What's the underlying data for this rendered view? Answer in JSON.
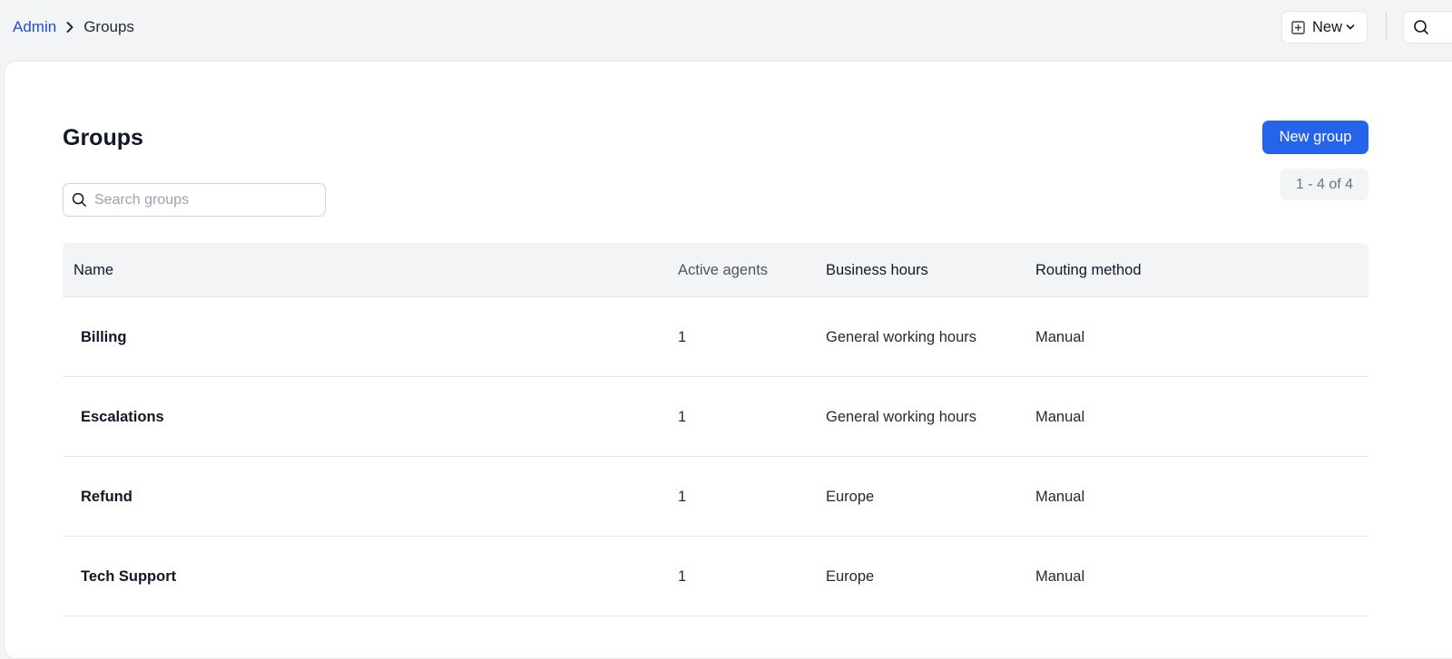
{
  "breadcrumb": {
    "parent": "Admin",
    "current": "Groups"
  },
  "topbar": {
    "new_label": "New",
    "icons": [
      "plus-square-icon",
      "chevron-down-icon",
      "search-icon"
    ]
  },
  "page": {
    "title": "Groups",
    "primary_button": "New group",
    "search_placeholder": "Search groups",
    "pagination": "1 - 4 of 4"
  },
  "table": {
    "columns": {
      "name": "Name",
      "agents": "Active agents",
      "hours": "Business hours",
      "routing": "Routing method"
    },
    "rows": [
      {
        "name": "Billing",
        "agents": "1",
        "hours": "General working hours",
        "routing": "Manual"
      },
      {
        "name": "Escalations",
        "agents": "1",
        "hours": "General working hours",
        "routing": "Manual"
      },
      {
        "name": "Refund",
        "agents": "1",
        "hours": "Europe",
        "routing": "Manual"
      },
      {
        "name": "Tech Support",
        "agents": "1",
        "hours": "Europe",
        "routing": "Manual"
      }
    ]
  },
  "colors": {
    "accent": "#2563eb",
    "link": "#1d4ed8",
    "background": "#f3f4f6"
  }
}
